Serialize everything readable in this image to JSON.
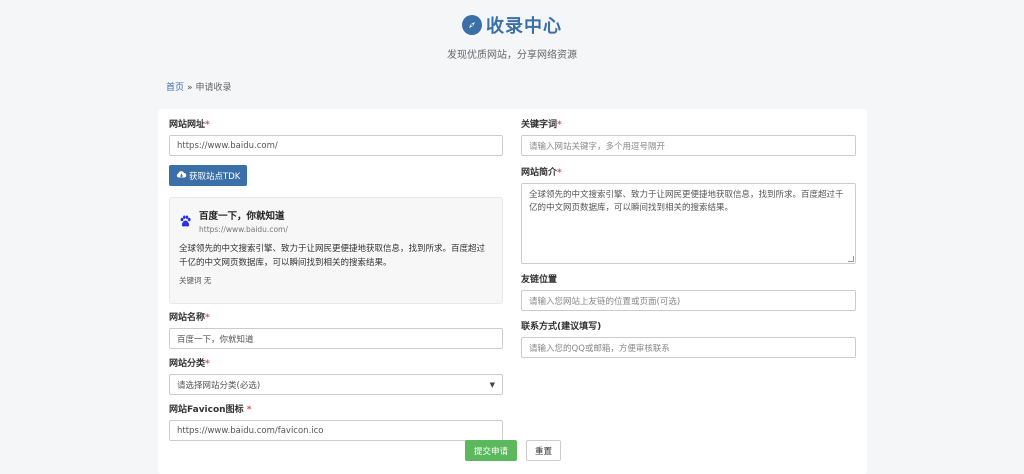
{
  "header": {
    "title": "收录中心",
    "subtitle": "发现优质网站，分享网络资源"
  },
  "breadcrumb": {
    "home": "首页",
    "separator": "»",
    "current": "申请收录"
  },
  "form": {
    "url": {
      "label": "网站网址",
      "required_mark": "*",
      "value": "https://www.baidu.com/"
    },
    "fetch_tdk_button": "获取站点TDK",
    "preview": {
      "title": "百度一下，你就知道",
      "url": "https://www.baidu.com/",
      "description": "全球领先的中文搜索引擎、致力于让网民更便捷地获取信息，找到所求。百度超过千亿的中文网页数据库，可以瞬间找到相关的搜索结果。",
      "keywords_label": "关键词",
      "keywords_value": "无"
    },
    "name": {
      "label": "网站名称",
      "required_mark": "*",
      "value": "百度一下，你就知道"
    },
    "category": {
      "label": "网站分类",
      "required_mark": "*",
      "value": "请选择网站分类(必选)"
    },
    "favicon": {
      "label": "网站Favicon图标 ",
      "required_mark": "*",
      "value": "https://www.baidu.com/favicon.ico"
    },
    "keywords": {
      "label": "关键字词",
      "required_mark": "*",
      "placeholder": "请输入网站关键字，多个用逗号隔开"
    },
    "intro": {
      "label": "网站简介",
      "required_mark": "*",
      "value": "全球领先的中文搜索引擎、致力于让网民更便捷地获取信息，找到所求。百度超过千亿的中文网页数据库，可以瞬间找到相关的搜索结果。"
    },
    "link_position": {
      "label": "友链位置",
      "placeholder": "请输入您网站上友链的位置或页面(可选)"
    },
    "contact": {
      "label": "联系方式(建议填写)",
      "placeholder": "请输入您的QQ或邮箱，方便审核联系"
    },
    "submit_button": "提交申请",
    "reset_button": "重置"
  },
  "colors": {
    "accent": "#3a6fa8",
    "submit": "#5cb85c",
    "required": "#d9534f",
    "background": "#f5f6f8"
  },
  "icons": {
    "brand": "compass-icon",
    "fetch": "cloud-download-icon",
    "preview_site": "baidu-paw-icon",
    "select": "chevron-down-icon"
  }
}
